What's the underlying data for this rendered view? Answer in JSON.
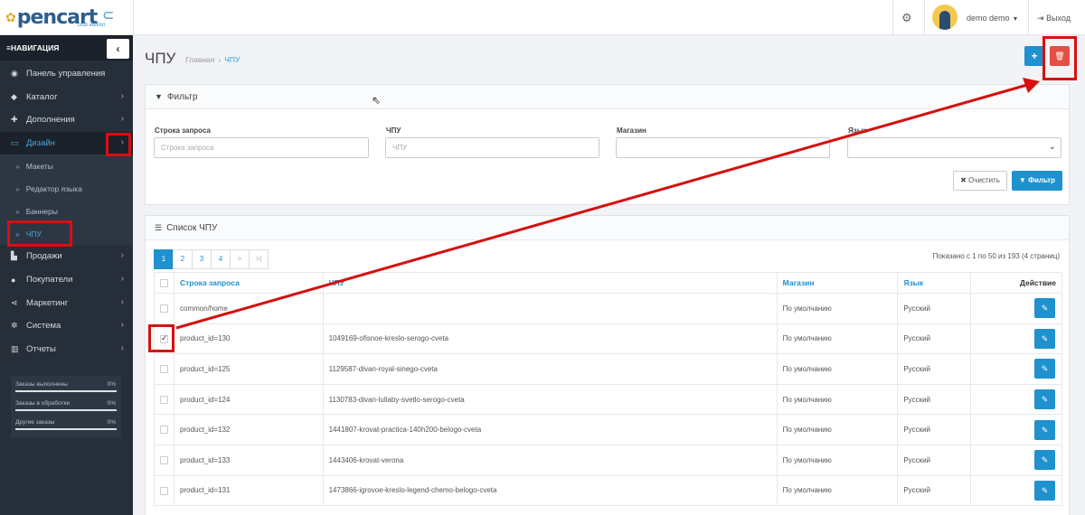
{
  "header": {
    "logo_text": "pencart",
    "logo_sub": "club edition",
    "user_name": "demo demo",
    "logout_label": "Выход"
  },
  "sidebar": {
    "nav_title": "НАВИГАЦИЯ",
    "items": [
      {
        "label": "Панель управления",
        "icon": "dashboard-icon"
      },
      {
        "label": "Каталог",
        "icon": "tags-icon"
      },
      {
        "label": "Дополнения",
        "icon": "puzzle-icon"
      },
      {
        "label": "Дизайн",
        "icon": "monitor-icon"
      },
      {
        "label": "Продажи",
        "icon": "cart-icon"
      },
      {
        "label": "Покупатели",
        "icon": "user-icon"
      },
      {
        "label": "Маркетинг",
        "icon": "share-icon"
      },
      {
        "label": "Система",
        "icon": "cog-icon"
      },
      {
        "label": "Отчеты",
        "icon": "bar-chart-icon"
      }
    ],
    "design_sub": [
      {
        "label": "Макеты"
      },
      {
        "label": "Редактор языка"
      },
      {
        "label": "Баннеры"
      },
      {
        "label": "ЧПУ"
      }
    ],
    "stats": [
      {
        "label": "Заказы выполнены",
        "value": "0%"
      },
      {
        "label": "Заказы в обработке",
        "value": "0%"
      },
      {
        "label": "Другие заказы",
        "value": "0%"
      }
    ]
  },
  "page": {
    "title": "ЧПУ",
    "breadcrumb_home": "Главная",
    "breadcrumb_current": "ЧПУ"
  },
  "filter": {
    "title": "Фильтр",
    "query_label": "Строка запроса",
    "query_placeholder": "Строка запроса",
    "keyword_label": "ЧПУ",
    "keyword_placeholder": "ЧПУ",
    "store_label": "Магазин",
    "language_label": "Язык",
    "clear_label": "Очистить",
    "filter_label": "Фильтр"
  },
  "list": {
    "title": "Список ЧПУ",
    "pages": [
      "1",
      "2",
      "3",
      "4",
      ">",
      ">|"
    ],
    "summary": "Показано с 1 по 50 из 193 (4 страниц)",
    "columns": {
      "query": "Строка запроса",
      "keyword": "ЧПУ",
      "store": "Магазин",
      "language": "Язык",
      "action": "Действие"
    },
    "rows": [
      {
        "query": "common/home",
        "keyword": "",
        "store": "По умолчанию",
        "language": "Русский",
        "checked": false
      },
      {
        "query": "product_id=130",
        "keyword": "1049169-ofisnoe-kreslo-serogo-cveta",
        "store": "По умолчанию",
        "language": "Русский",
        "checked": true
      },
      {
        "query": "product_id=125",
        "keyword": "1129587-divan-royal-sinego-cveta",
        "store": "По умолчанию",
        "language": "Русский",
        "checked": false
      },
      {
        "query": "product_id=124",
        "keyword": "1130783-divan-lullaby-svetlo-serogo-cveta",
        "store": "По умолчанию",
        "language": "Русский",
        "checked": false
      },
      {
        "query": "product_id=132",
        "keyword": "1441807-krovat-practica-140h200-belogo-cveta",
        "store": "По умолчанию",
        "language": "Русский",
        "checked": false
      },
      {
        "query": "product_id=133",
        "keyword": "1443406-krovat-verona",
        "store": "По умолчанию",
        "language": "Русский",
        "checked": false
      },
      {
        "query": "product_id=131",
        "keyword": "1473866-igrovoe-kreslo-legend-chemo-belogo-cveta",
        "store": "По умолчанию",
        "language": "Русский",
        "checked": false
      }
    ]
  },
  "colors": {
    "primary": "#1e91cf",
    "danger": "#e35046",
    "sidebar_bg": "#252e39",
    "highlight": "#d80f0f"
  }
}
